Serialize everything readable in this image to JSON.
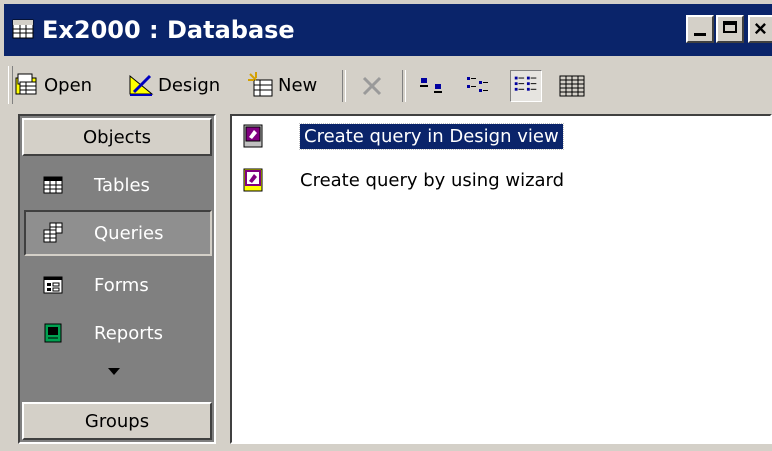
{
  "window": {
    "title": "Ex2000 : Database",
    "title_bar_color": "#0a246a",
    "caption_buttons": [
      "minimize",
      "maximize",
      "close"
    ],
    "close_glyph": "×"
  },
  "toolbar": {
    "open_label": "Open",
    "design_label": "Design",
    "new_label": "New",
    "icons": [
      "open-icon",
      "design-icon",
      "new-icon",
      "delete-icon",
      "large-icons-icon",
      "small-icons-icon",
      "list-view-icon",
      "details-view-icon"
    ]
  },
  "objects_bar": {
    "header": "Objects",
    "items": [
      {
        "label": "Tables",
        "icon": "table-icon"
      },
      {
        "label": "Queries",
        "icon": "query-icon",
        "selected": true
      },
      {
        "label": "Forms",
        "icon": "form-icon"
      },
      {
        "label": "Reports",
        "icon": "report-icon"
      }
    ],
    "groups_header": "Groups"
  },
  "list": {
    "items": [
      {
        "label": "Create query in Design view",
        "selected": true,
        "icon": "design-query-icon"
      },
      {
        "label": "Create query by using wizard",
        "selected": false,
        "icon": "wizard-query-icon"
      }
    ]
  }
}
